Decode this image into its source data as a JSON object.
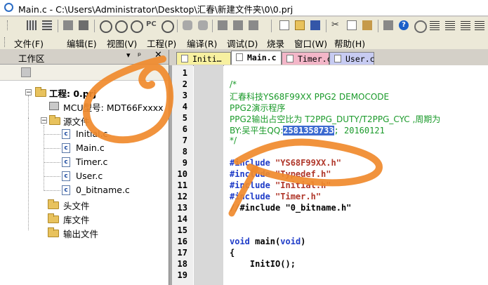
{
  "window": {
    "title": "Main.c - C:\\Users\\Administrator\\Desktop\\汇春\\新建文件夹\\0\\0.prj"
  },
  "menubar": {
    "items": [
      "文件(F)",
      "编辑(E)",
      "视图(V)",
      "工程(P)",
      "编译(R)",
      "调试(D)",
      "烧录",
      "窗口(W)",
      "帮助(H)"
    ]
  },
  "workspace": {
    "title": "工作区",
    "pin": "▾ ᵖ ✕",
    "tree": {
      "project": "工程: 0.prj",
      "mcu": "MCU型号: MDT66Fxxxx",
      "source_folder": "源文件",
      "source_files": [
        "Initial.c",
        "Main.c",
        "Timer.c",
        "User.c",
        "0_bitname.c"
      ],
      "header_folder": "头文件",
      "lib_folder": "库文件",
      "output_folder": "输出文件"
    }
  },
  "editor": {
    "tabs": [
      "Initi…",
      "Main.c",
      "Timer.c",
      "User.c"
    ],
    "active_tab": "Main.c",
    "line_numbers": [
      "1",
      "2",
      "3",
      "4",
      "5",
      "6",
      "7",
      "8",
      "9",
      "10",
      "11",
      "12",
      "13",
      "14",
      "15",
      "16",
      "17",
      "18",
      "19"
    ],
    "lines": [
      {
        "type": "blank",
        "text": ""
      },
      {
        "type": "comment",
        "text": "/*"
      },
      {
        "type": "comment",
        "text": "汇春科技YS68F99XX PPG2 DEMOCODE"
      },
      {
        "type": "comment",
        "text": "PPG2演示程序"
      },
      {
        "type": "comment",
        "text": "PPG2输出占空比为 T2PPG_DUTY/T2PPG_CYC ,周期为"
      },
      {
        "type": "comment-sel",
        "pre": "BY:吴平生QQ:",
        "sel": "2581358733",
        "post": "; 20160121"
      },
      {
        "type": "comment",
        "text": "*/"
      },
      {
        "type": "blank",
        "text": ""
      },
      {
        "type": "include",
        "kw": "#include",
        "str": " \"YS68F99XX.h\""
      },
      {
        "type": "include",
        "kw": "#include",
        "str": " \"Typedef.h\""
      },
      {
        "type": "include",
        "kw": "#include",
        "str": " \"Initial.h\""
      },
      {
        "type": "include",
        "kw": "#include",
        "str": " \"Timer.h\""
      },
      {
        "type": "plain",
        "text": "//#include \"0_bitname.h\""
      },
      {
        "type": "blank",
        "text": ""
      },
      {
        "type": "blank",
        "text": ""
      },
      {
        "type": "main",
        "kw": "void",
        "rest": " main(",
        "kw2": "void",
        "end": ")"
      },
      {
        "type": "plain",
        "text": "{"
      },
      {
        "type": "plain",
        "text": "    InitIO();"
      },
      {
        "type": "blank",
        "text": ""
      }
    ]
  },
  "colors": {
    "comment": "#1a9a2a",
    "keyword": "#1f3cc8",
    "string": "#b0372a",
    "selection": "#3c6ad0",
    "scribble": "#f08a2c"
  }
}
